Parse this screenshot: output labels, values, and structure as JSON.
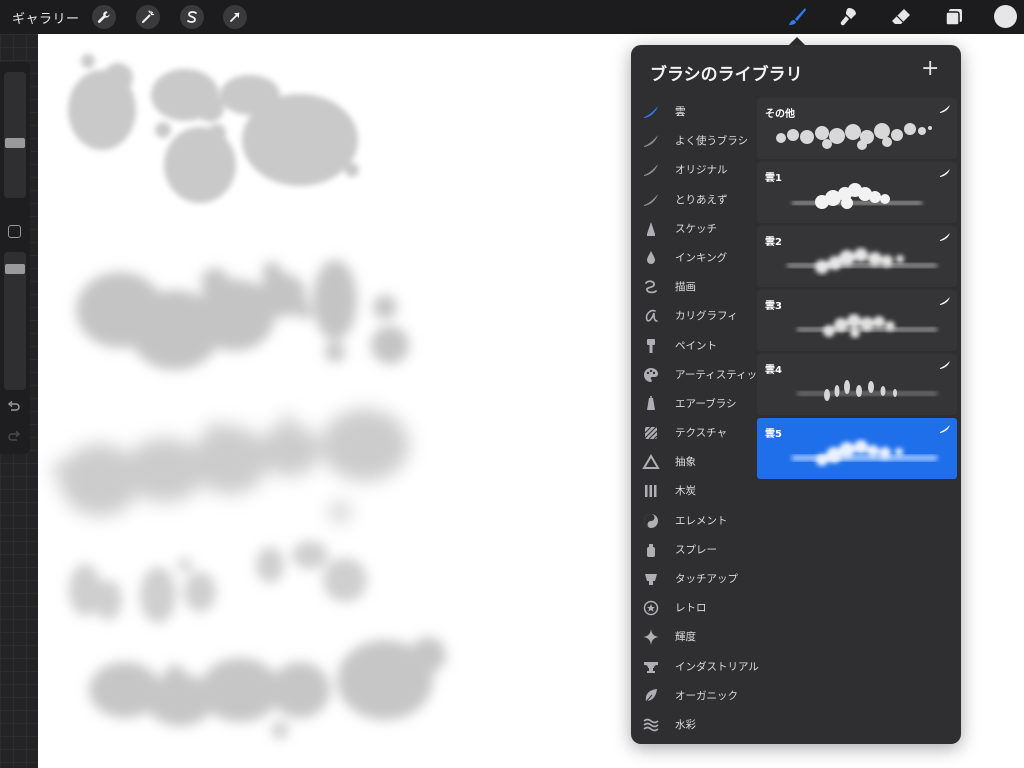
{
  "app": {
    "gallery_label": "ギャラリー"
  },
  "toolbar": {
    "left_tools": [
      "wrench-icon",
      "magic-wand-icon",
      "selection-s-icon",
      "transform-arrow-icon"
    ],
    "right_tools": [
      "brush-icon",
      "smudge-icon",
      "eraser-icon",
      "layers-icon"
    ],
    "active_tool": "brush-icon",
    "accent_color": "#2d7cf6",
    "current_color": "#e6e6e6"
  },
  "sidebar": {
    "brush_size": 0.55,
    "opacity": 0.15,
    "undo_icon": "undo-icon",
    "redo_icon": "redo-icon"
  },
  "panel": {
    "title": "ブラシのライブラリ",
    "add_label": "+",
    "categories": [
      {
        "label": "雲",
        "icon": "brush-stroke-icon",
        "active": true
      },
      {
        "label": "よく使うブラシ",
        "icon": "brush-stroke-icon"
      },
      {
        "label": "オリジナル",
        "icon": "brush-stroke-icon"
      },
      {
        "label": "とりあえず",
        "icon": "brush-stroke-icon"
      },
      {
        "label": "スケッチ",
        "icon": "pencil-tip-icon"
      },
      {
        "label": "インキング",
        "icon": "ink-drop-icon"
      },
      {
        "label": "描画",
        "icon": "curl-icon"
      },
      {
        "label": "カリグラフィ",
        "icon": "calligraphy-icon"
      },
      {
        "label": "ペイント",
        "icon": "paint-brush-icon"
      },
      {
        "label": "アーティスティック",
        "icon": "palette-icon"
      },
      {
        "label": "エアーブラシ",
        "icon": "airbrush-icon"
      },
      {
        "label": "テクスチャ",
        "icon": "texture-icon"
      },
      {
        "label": "抽象",
        "icon": "triangle-icon"
      },
      {
        "label": "木炭",
        "icon": "charcoal-icon"
      },
      {
        "label": "エレメント",
        "icon": "yin-yang-icon"
      },
      {
        "label": "スプレー",
        "icon": "spray-can-icon"
      },
      {
        "label": "タッチアップ",
        "icon": "touchup-icon"
      },
      {
        "label": "レトロ",
        "icon": "star-badge-icon"
      },
      {
        "label": "輝度",
        "icon": "sparkle-icon"
      },
      {
        "label": "インダストリアル",
        "icon": "anvil-icon"
      },
      {
        "label": "オーガニック",
        "icon": "leaf-icon"
      },
      {
        "label": "水彩",
        "icon": "waves-icon"
      }
    ],
    "brushes": [
      {
        "name": "その他",
        "selected": false
      },
      {
        "name": "雲1",
        "selected": false
      },
      {
        "name": "雲2",
        "selected": false
      },
      {
        "name": "雲3",
        "selected": false
      },
      {
        "name": "雲4",
        "selected": false
      },
      {
        "name": "雲5",
        "selected": true
      }
    ]
  }
}
